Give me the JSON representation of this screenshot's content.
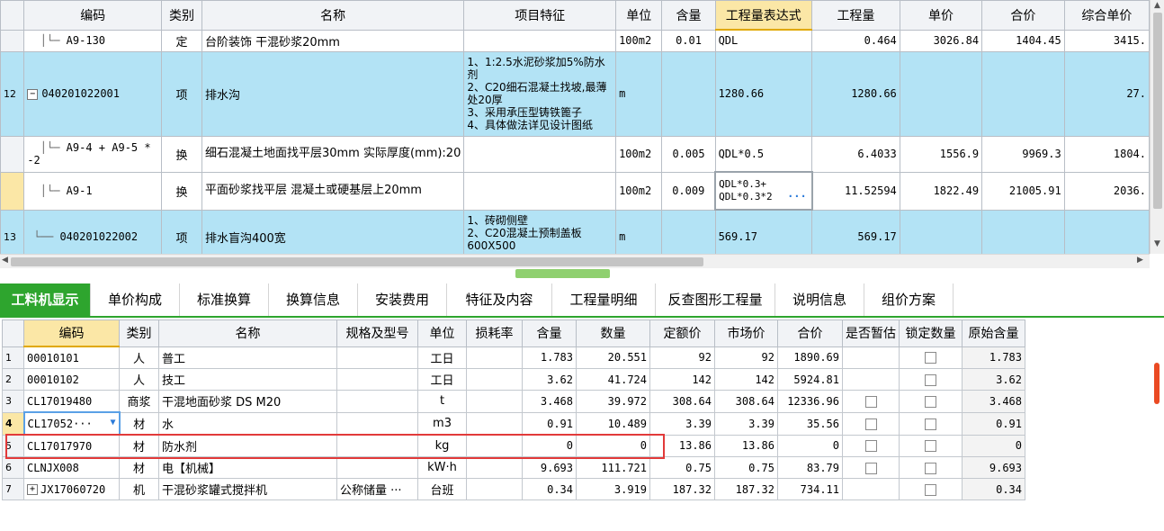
{
  "upper": {
    "headers": [
      "编码",
      "类别",
      "名称",
      "项目特征",
      "单位",
      "含量",
      "工程量表达式",
      "工程量",
      "单价",
      "合价",
      "综合单价"
    ],
    "rows": [
      {
        "num": "",
        "code": "A9-130",
        "type": "定",
        "name": "台阶装饰 干混砂浆20mm",
        "feature": "",
        "unit": "100m2",
        "qty": "0.01",
        "expr": "QDL",
        "amount": "0.464",
        "price": "3026.84",
        "total": "1404.45",
        "comp": "3415."
      },
      {
        "num": "12",
        "code": "040201022001",
        "type": "项",
        "name": "排水沟",
        "feature": "1、1:2.5水泥砂浆加5%防水剂\n2、C20细石混凝土找坡,最薄处20厚\n3、采用承压型铸铁篦子\n4、具体做法详见设计图纸",
        "unit": "m",
        "qty": "",
        "expr": "1280.66",
        "amount": "1280.66",
        "price": "",
        "total": "",
        "comp": "27."
      },
      {
        "num": "",
        "code": "A9-4 + A9-5 * -2",
        "type": "换",
        "name": "细石混凝土地面找平层30mm  实际厚度(mm):20",
        "feature": "",
        "unit": "100m2",
        "qty": "0.005",
        "expr": "QDL*0.5",
        "amount": "6.4033",
        "price": "1556.9",
        "total": "9969.3",
        "comp": "1804."
      },
      {
        "num": "",
        "code": "A9-1",
        "type": "换",
        "name": "平面砂浆找平层 混凝土或硬基层上20mm",
        "feature": "",
        "unit": "100m2",
        "qty": "0.009",
        "expr": "QDL*0.3+ QDL*0.3*2",
        "amount": "11.52594",
        "price": "1822.49",
        "total": "21005.91",
        "comp": "2036."
      },
      {
        "num": "13",
        "code": "040201022002",
        "type": "项",
        "name": "排水盲沟400宽",
        "feature": "1、砖砌侧壁\n2、C20混凝土预制盖板\n600X500",
        "unit": "m",
        "qty": "",
        "expr": "569.17",
        "amount": "569.17",
        "price": "",
        "total": "",
        "comp": ""
      }
    ],
    "ellipsis": "···"
  },
  "tabs": [
    "工料机显示",
    "单价构成",
    "标准换算",
    "换算信息",
    "安装费用",
    "特征及内容",
    "工程量明细",
    "反查图形工程量",
    "说明信息",
    "组价方案"
  ],
  "lower": {
    "headers": [
      "编码",
      "类别",
      "名称",
      "规格及型号",
      "单位",
      "损耗率",
      "含量",
      "数量",
      "定额价",
      "市场价",
      "合价",
      "是否暂估",
      "锁定数量",
      "原始含量"
    ],
    "rows": [
      {
        "num": "1",
        "code": "00010101",
        "type": "人",
        "name": "普工",
        "spec": "",
        "unit": "工日",
        "loss": "",
        "qty": "1.783",
        "count": "20.551",
        "base": "92",
        "market": "92",
        "total": "1890.69",
        "est": false,
        "lock": true,
        "orig": "1.783"
      },
      {
        "num": "2",
        "code": "00010102",
        "type": "人",
        "name": "技工",
        "spec": "",
        "unit": "工日",
        "loss": "",
        "qty": "3.62",
        "count": "41.724",
        "base": "142",
        "market": "142",
        "total": "5924.81",
        "est": false,
        "lock": true,
        "orig": "3.62"
      },
      {
        "num": "3",
        "code": "CL17019480",
        "type": "商浆",
        "name": "干混地面砂浆 DS M20",
        "spec": "",
        "unit": "t",
        "loss": "",
        "qty": "3.468",
        "count": "39.972",
        "base": "308.64",
        "market": "308.64",
        "total": "12336.96",
        "est": true,
        "lock": true,
        "orig": "3.468"
      },
      {
        "num": "4",
        "code": "CL17052···",
        "type": "材",
        "name": "水",
        "spec": "",
        "unit": "m3",
        "loss": "",
        "qty": "0.91",
        "count": "10.489",
        "base": "3.39",
        "market": "3.39",
        "total": "35.56",
        "est": true,
        "lock": true,
        "orig": "0.91"
      },
      {
        "num": "5",
        "code": "CL17017970",
        "type": "材",
        "name": "防水剂",
        "spec": "",
        "unit": "kg",
        "loss": "",
        "qty": "0",
        "count": "0",
        "base": "13.86",
        "market": "13.86",
        "total": "0",
        "est": true,
        "lock": true,
        "orig": "0"
      },
      {
        "num": "6",
        "code": "CLNJX008",
        "type": "材",
        "name": "电【机械】",
        "spec": "",
        "unit": "kW·h",
        "loss": "",
        "qty": "9.693",
        "count": "111.721",
        "base": "0.75",
        "market": "0.75",
        "total": "83.79",
        "est": true,
        "lock": true,
        "orig": "9.693"
      },
      {
        "num": "7",
        "code": "JX17060720",
        "type": "机",
        "name": "干混砂浆罐式搅拌机",
        "spec": "公称储量 ···",
        "unit": "台班",
        "loss": "",
        "qty": "0.34",
        "count": "3.919",
        "base": "187.32",
        "market": "187.32",
        "total": "734.11",
        "est": false,
        "lock": true,
        "orig": "0.34"
      }
    ]
  }
}
